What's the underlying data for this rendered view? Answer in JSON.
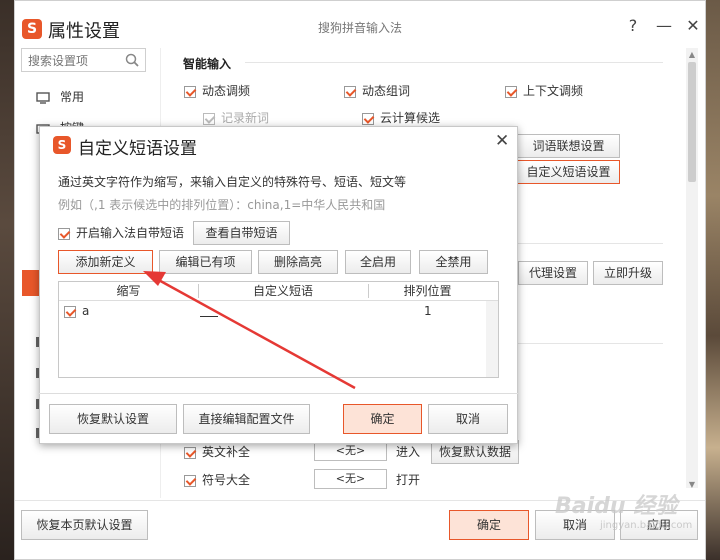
{
  "window": {
    "title": "属性设置",
    "center_title": "搜狗拼音输入法",
    "help_symbol": "?",
    "minimize_symbol": "—",
    "close_symbol": "✕",
    "logo_letter": "S"
  },
  "search": {
    "placeholder": "搜索设置项"
  },
  "sidebar": {
    "items": [
      {
        "label": "常用"
      },
      {
        "label": "按键"
      }
    ]
  },
  "smart_input": {
    "title": "智能输入",
    "options": [
      {
        "label": "动态调频",
        "checked": true
      },
      {
        "label": "动态组词",
        "checked": true
      },
      {
        "label": "上下文调频",
        "checked": true
      },
      {
        "label": "记录新词",
        "checked": true,
        "disabled": true
      },
      {
        "label": "云计算候选",
        "checked": true
      }
    ],
    "btn_word_assoc": "词语联想设置",
    "btn_custom_phrase": "自定义短语设置"
  },
  "network": {
    "btn_proxy": "代理设置",
    "btn_upgrade": "立即升级"
  },
  "advanced": {
    "rows": [
      {
        "label": "英文补全",
        "value": "<无>",
        "suffix": "进入",
        "checked": true
      },
      {
        "label": "符号大全",
        "value": "<无>",
        "suffix": "打开",
        "checked": true
      }
    ],
    "btn_restore_data": "恢复默认数据"
  },
  "footer": {
    "restore_page": "恢复本页默认设置",
    "ok": "确定",
    "cancel": "取消",
    "apply": "应用"
  },
  "dialog": {
    "title": "自定义短语设置",
    "close_symbol": "✕",
    "description": "通过英文字符作为缩写，来输入自定义的特殊符号、短语、短文等",
    "example": "例如（,1 表示候选中的排列位置）：china,1=中华人民共和国",
    "enable_label": "开启输入法自带短语",
    "enable_checked": true,
    "view_builtin": "查看自带短语",
    "toolbar": [
      "添加新定义",
      "编辑已有项",
      "删除高亮",
      "全启用",
      "全禁用"
    ],
    "table": {
      "columns": [
        "缩写",
        "自定义短语",
        "排列位置"
      ],
      "rows": [
        {
          "abbr": "a",
          "phrase": "",
          "position": "1",
          "checked": true
        }
      ]
    },
    "btn_restore": "恢复默认设置",
    "btn_edit_config": "直接编辑配置文件",
    "btn_ok": "确定",
    "btn_cancel": "取消"
  },
  "watermark": {
    "text": "Baidu 经验",
    "sub": "jingyan.baidu.com"
  },
  "colors": {
    "accent": "#e8572a",
    "arrow": "#e53935"
  }
}
